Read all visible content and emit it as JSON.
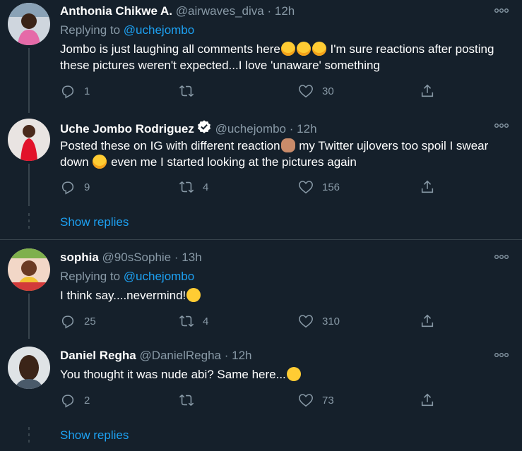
{
  "tweets": [
    {
      "name": "Anthonia Chikwe A.",
      "handle": "@airwaves_diva",
      "sep": "·",
      "time": "12h",
      "replying_prefix": "Replying to",
      "replying_to": "@uchejombo",
      "text_1": "Jombo is just laughing all comments here",
      "text_2": " I'm  sure reactions after posting these pictures weren't expected...I love 'unaware' something",
      "replies": "1",
      "retweets": "",
      "likes": "30"
    },
    {
      "name": "Uche Jombo Rodriguez",
      "handle": "@uchejombo",
      "sep": "·",
      "time": "12h",
      "text_1": "Posted these on IG with different reaction",
      "text_2": " my Twitter ujlovers too spoil I swear down ",
      "text_3": " even me I started looking at the pictures again",
      "replies": "9",
      "retweets": "4",
      "likes": "156",
      "show_replies": "Show replies"
    },
    {
      "name": "sophia",
      "handle": "@90sSophie",
      "sep": "·",
      "time": "13h",
      "replying_prefix": "Replying to",
      "replying_to": "@uchejombo",
      "text_1": "I think say....nevermind!",
      "replies": "25",
      "retweets": "4",
      "likes": "310"
    },
    {
      "name": "Daniel Regha",
      "handle": "@DanielRegha",
      "sep": "·",
      "time": "12h",
      "text_1": "You thought it was nude abi? Same here...",
      "replies": "2",
      "retweets": "",
      "likes": "73",
      "show_replies": "Show replies"
    }
  ],
  "icons": {
    "reply": "reply-icon",
    "retweet": "retweet-icon",
    "like": "heart-icon",
    "share": "share-icon",
    "more": "more-icon",
    "verified": "verified-icon"
  },
  "colors": {
    "background": "#15202b",
    "muted": "#8899a6",
    "accent": "#1da1f2",
    "divider": "#38444d"
  }
}
